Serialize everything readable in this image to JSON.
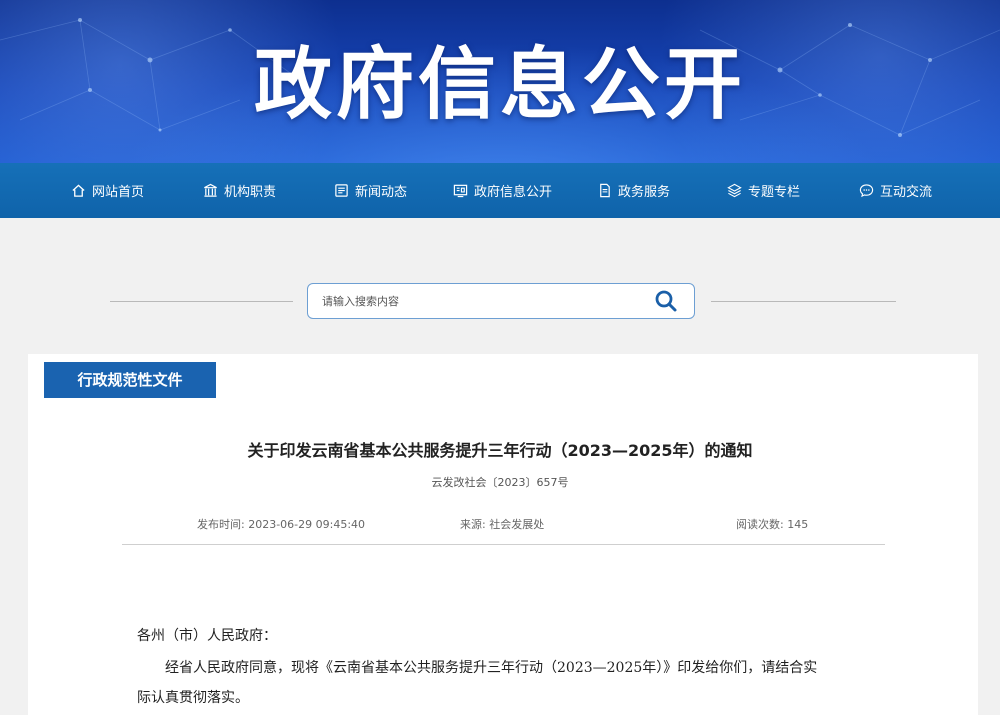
{
  "banner": {
    "title": "政府信息公开"
  },
  "nav": {
    "items": [
      {
        "label": "网站首页",
        "icon": "home-icon"
      },
      {
        "label": "机构职责",
        "icon": "building-icon"
      },
      {
        "label": "新闻动态",
        "icon": "news-icon"
      },
      {
        "label": "政府信息公开",
        "icon": "info-board-icon"
      },
      {
        "label": "政务服务",
        "icon": "document-icon"
      },
      {
        "label": "专题专栏",
        "icon": "layers-icon"
      },
      {
        "label": "互动交流",
        "icon": "chat-icon"
      }
    ]
  },
  "search": {
    "placeholder": "请输入搜索内容"
  },
  "section": {
    "tag": "行政规范性文件"
  },
  "document": {
    "title": "关于印发云南省基本公共服务提升三年行动（2023—2025年）的通知",
    "number": "云发改社会〔2023〕657号",
    "publish_label": "发布时间:",
    "publish_time": "2023-06-29 09:45:40",
    "source_label": "来源:",
    "source": "社会发展处",
    "views_label": "阅读次数:",
    "views": "145",
    "salutation": "各州（市）人民政府：",
    "paragraph_1": "经省人民政府同意，现将《云南省基本公共服务提升三年行动（2023—2025年）》印发给你们，请结合实",
    "paragraph_1_cont": "际认真贯彻落实。"
  },
  "colors": {
    "nav_bg": "#1670b8",
    "tag_bg": "#1a63b0",
    "banner_bg": "#1746b8"
  }
}
